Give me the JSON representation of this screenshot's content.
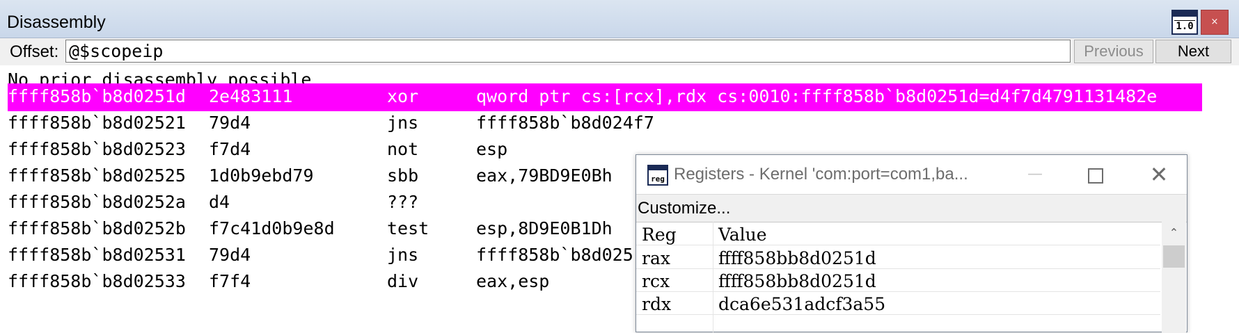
{
  "window": {
    "title": "Disassembly",
    "app_icon_text": "1.0",
    "close_glyph": "×"
  },
  "offset_bar": {
    "label": "Offset:",
    "value": "@$scopeip",
    "previous_label": "Previous",
    "next_label": "Next"
  },
  "listing": {
    "message": "No prior disassembly possible",
    "highlight_color": "#ff00ff",
    "rows": [
      {
        "addr": "ffff858b`b8d0251d",
        "bytes": "2e483111",
        "op": "xor",
        "args": "qword ptr cs:[rcx],rdx cs:0010:ffff858b`b8d0251d=d4f7d4791131482e",
        "highlighted": true
      },
      {
        "addr": "ffff858b`b8d02521",
        "bytes": "79d4",
        "op": "jns",
        "args": "ffff858b`b8d024f7",
        "highlighted": false
      },
      {
        "addr": "ffff858b`b8d02523",
        "bytes": "f7d4",
        "op": "not",
        "args": "esp",
        "highlighted": false
      },
      {
        "addr": "ffff858b`b8d02525",
        "bytes": "1d0b9ebd79",
        "op": "sbb",
        "args": "eax,79BD9E0Bh",
        "highlighted": false
      },
      {
        "addr": "ffff858b`b8d0252a",
        "bytes": "d4",
        "op": "???",
        "args": "",
        "highlighted": false
      },
      {
        "addr": "ffff858b`b8d0252b",
        "bytes": "f7c41d0b9e8d",
        "op": "test",
        "args": "esp,8D9E0B1Dh",
        "highlighted": false
      },
      {
        "addr": "ffff858b`b8d02531",
        "bytes": "79d4",
        "op": "jns",
        "args": "ffff858b`b8d025",
        "highlighted": false
      },
      {
        "addr": "ffff858b`b8d02533",
        "bytes": "f7f4",
        "op": "div",
        "args": "eax,esp",
        "highlighted": false
      }
    ]
  },
  "registers_window": {
    "title": "Registers - Kernel 'com:port=com1,ba...",
    "icon_text": "reg",
    "minimize_glyph": "—",
    "close_glyph": "✕",
    "customize_label": "Customize...",
    "columns": [
      "Reg",
      "Value"
    ],
    "rows": [
      {
        "reg": "rax",
        "value": "ffff858bb8d0251d"
      },
      {
        "reg": "rcx",
        "value": "ffff858bb8d0251d"
      },
      {
        "reg": "rdx",
        "value": "dca6e531adcf3a55"
      }
    ],
    "scroll_up_glyph": "⌃"
  }
}
